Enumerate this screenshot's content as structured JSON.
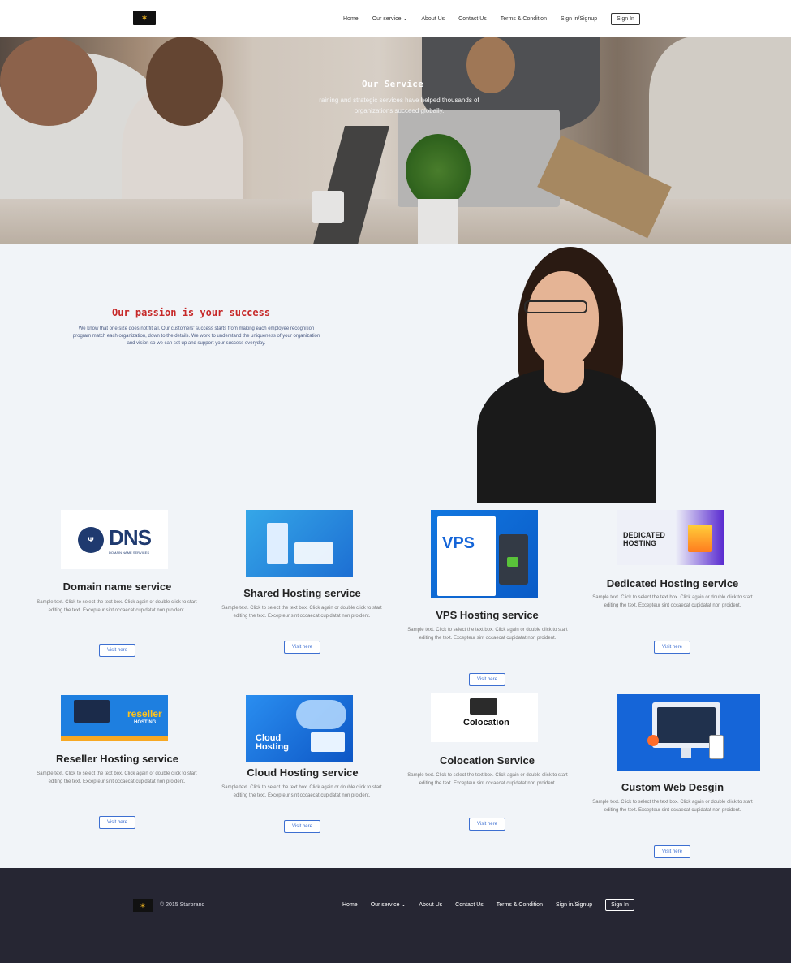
{
  "header": {
    "logo_icon": "brand-logo-icon",
    "nav": {
      "home": "Home",
      "our_service": "Our service",
      "about": "About Us",
      "contact": "Contact Us",
      "terms": "Terms & Condition",
      "signup": "Sign in/Signup",
      "signin": "Sign In"
    }
  },
  "hero": {
    "title": "Our Service",
    "subtitle": "raining and strategic services have helped thousands of organizations succeed globally."
  },
  "passion": {
    "title": "Our passion is your success",
    "text": "We know that one size does not fit all. Our customers' success starts from making each employee recognition program match each organization, down to the details. We work to understand the uniqueness of your organization and vision so we can set up and support your success everyday."
  },
  "services": [
    {
      "title": "Domain name service",
      "desc": "Sample text. Click to select the text box. Click again or double click to start editing the text. Excepteur sint occaecat cupidatat non proident.",
      "button": "Visit here",
      "image_label": "DNS",
      "image_sub": "DOMAIN NAME SERVICES"
    },
    {
      "title": "Shared Hosting service",
      "desc": "Sample text. Click to select the text box. Click again or double click to start editing the text. Excepteur sint occaecat cupidatat non proident.",
      "button": "Visit here"
    },
    {
      "title": "VPS Hosting service",
      "desc": "Sample text. Click to select the text box. Click again or double click to start editing the text. Excepteur sint occaecat cupidatat non proident.",
      "button": "Visit here",
      "image_label": "VPS"
    },
    {
      "title": "Dedicated Hosting service",
      "desc": "Sample text. Click to select the text box. Click again or double click to start editing the text. Excepteur sint occaecat cupidatat non proident.",
      "button": "Visit here",
      "image_label": "DEDICATED HOSTING"
    },
    {
      "title": "Reseller Hosting service",
      "desc": "Sample text. Click to select the text box. Click again or double click to start editing the text. Excepteur sint occaecat cupidatat non proident.",
      "button": "Visit here",
      "image_label": "reseller",
      "image_sub": "HOSTING"
    },
    {
      "title": "Cloud Hosting service",
      "desc": "Sample text. Click to select the text box. Click again or double click to start editing the text. Excepteur sint occaecat cupidatat non proident.",
      "button": "Visit here",
      "image_label": "Cloud Hosting"
    },
    {
      "title": "Colocation Service",
      "desc": "Sample text. Click to select the text box. Click again or double click to start editing the text. Excepteur sint occaecat cupidatat non proident.",
      "button": "Visit here",
      "image_label": "Colocation"
    },
    {
      "title": "Custom Web Desgin",
      "desc": "Sample text. Click to select the text box. Click again or double click to start editing the text. Excepteur sint occaecat cupidatat non proident.",
      "button": "Visit here"
    }
  ],
  "footer": {
    "copyright": "© 2015 Starbrand",
    "nav": {
      "home": "Home",
      "our_service": "Our service",
      "about": "About Us",
      "contact": "Contact Us",
      "terms": "Terms & Condition",
      "signup": "Sign in/Signup",
      "signin": "Sign In"
    }
  },
  "colors": {
    "accent": "#3d6fd1",
    "passion_title": "#c62828",
    "footer_bg": "#262633",
    "page_bg": "#f1f4f8"
  }
}
